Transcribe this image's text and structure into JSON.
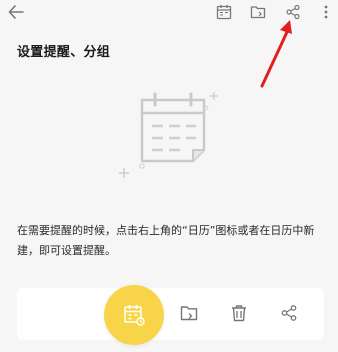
{
  "note": {
    "title": "设置提醒、分组",
    "hint_text": "在需要提醒的时候，点击右上角的“日历”图标或者在日历中新建，即可设置提醒。"
  },
  "icons": {
    "back": "back-arrow-icon",
    "calendar": "calendar-icon",
    "folder": "folder-move-icon",
    "share": "share-icon",
    "more": "more-vertical-icon",
    "delete": "trash-icon"
  },
  "colors": {
    "accent_yellow": "#f8d548",
    "annotation_red": "#e02020",
    "icon_gray": "#777777",
    "illustration_gray": "#c9c9c9"
  }
}
